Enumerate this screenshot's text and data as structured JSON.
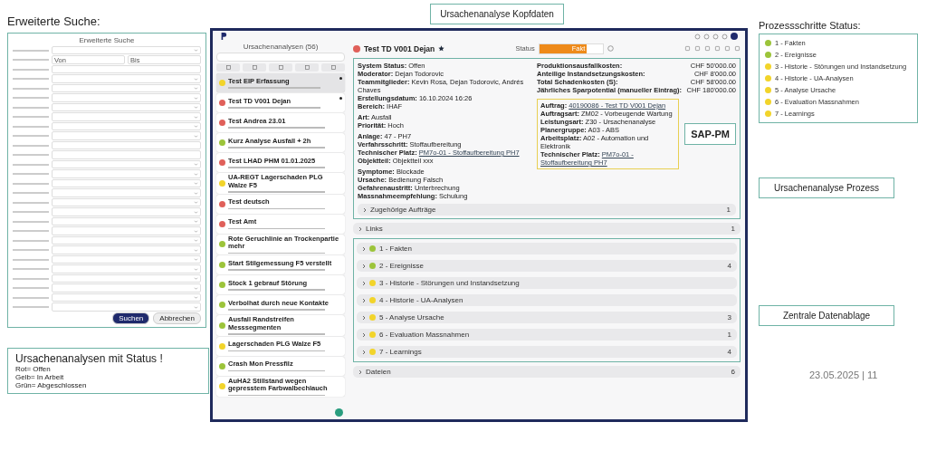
{
  "slide": {
    "date": "23.05.2025 | 11"
  },
  "search_panel": {
    "heading": "Erweiterte Suche:",
    "title": "Erweiterte Suche",
    "range": [
      "Von",
      "Bis"
    ],
    "fields": [
      {
        "kind": "select"
      },
      {
        "kind": "range"
      },
      {
        "kind": "text"
      },
      {
        "kind": "select"
      },
      {
        "kind": "select"
      },
      {
        "kind": "select"
      },
      {
        "kind": "select"
      },
      {
        "kind": "select"
      },
      {
        "kind": "select"
      },
      {
        "kind": "select"
      },
      {
        "kind": "text"
      },
      {
        "kind": "text"
      },
      {
        "kind": "select"
      },
      {
        "kind": "select"
      },
      {
        "kind": "select"
      },
      {
        "kind": "select"
      },
      {
        "kind": "select"
      },
      {
        "kind": "select"
      },
      {
        "kind": "select"
      },
      {
        "kind": "select"
      },
      {
        "kind": "select"
      },
      {
        "kind": "select"
      },
      {
        "kind": "select"
      },
      {
        "kind": "select"
      },
      {
        "kind": "select"
      },
      {
        "kind": "select"
      },
      {
        "kind": "select"
      },
      {
        "kind": "select"
      }
    ],
    "buttons": [
      {
        "label": "Suchen",
        "primary": true
      },
      {
        "label": "Abbrechen",
        "primary": false
      }
    ]
  },
  "status_note": {
    "title": "Ursachenanalysen mit Status !",
    "lines": [
      "Rot= Offen",
      "Gelb= In Arbeit",
      "Grün= Abgeschlossen"
    ]
  },
  "header_callout": "Ursachenanalyse Kopfdaten",
  "list": {
    "title": "Ursachenanalysen (56)",
    "items": [
      {
        "title": "Test EIP Erfassung",
        "color": "#f2d42a",
        "selected": true,
        "pinned": true
      },
      {
        "title": "Test TD V001 Dejan",
        "color": "#e0605a",
        "selected": false,
        "pinned": true
      },
      {
        "title": "Test Andrea 23.01",
        "color": "#e0605a",
        "selected": false,
        "pinned": false
      },
      {
        "title": "Kurz Analyse Ausfall + 2h",
        "color": "#9cc43a",
        "selected": false,
        "pinned": false
      },
      {
        "title": "Test LHAD PHM 01.01.2025",
        "color": "#e0605a",
        "selected": false,
        "pinned": false
      },
      {
        "title": "UA-REGT Lagerschaden PLG Walze F5",
        "color": "#f2d42a",
        "selected": false,
        "pinned": false
      },
      {
        "title": "Test deutsch",
        "color": "#e0605a",
        "selected": false,
        "pinned": false
      },
      {
        "title": "Test Amt",
        "color": "#e0605a",
        "selected": false,
        "pinned": false
      },
      {
        "title": "Rote Geruchlinie an Trockenpartie mehr",
        "color": "#9cc43a",
        "selected": false,
        "pinned": false
      },
      {
        "title": "Start Stilgemessung F5 verstellt",
        "color": "#9cc43a",
        "selected": false,
        "pinned": false
      },
      {
        "title": "Stock 1 gebrauf Störung",
        "color": "#9cc43a",
        "selected": false,
        "pinned": false
      },
      {
        "title": "Verbolhat durch neue Kontakte",
        "color": "#9cc43a",
        "selected": false,
        "pinned": false
      },
      {
        "title": "Ausfall Randstreifen Messsegmenten",
        "color": "#9cc43a",
        "selected": false,
        "pinned": false
      },
      {
        "title": "Lagerschaden PLG Walze F5",
        "color": "#f2d42a",
        "selected": false,
        "pinned": false
      },
      {
        "title": "Crash Mon Pressfilz",
        "color": "#9cc43a",
        "selected": false,
        "pinned": false
      },
      {
        "title": "AuHA2 Stillstand wegen gepresstem Farbwalbechlauch",
        "color": "#f2d42a",
        "selected": false,
        "pinned": false
      }
    ]
  },
  "detail": {
    "title": "Test TD V001 Dejan",
    "color": "#e0605a",
    "status": {
      "label": "Status",
      "text": "Fakt",
      "level": 0.75
    },
    "field_groups": [
      {
        "fields": [
          {
            "label": "System Status:",
            "value": "Offen",
            "link": false
          },
          {
            "label": "Moderator:",
            "value": "Dejan Todorovic",
            "link": false
          },
          {
            "label": "Teammitglieder:",
            "value": "Kevin Rosa, Dejan Todorovic, Andrés Chaves",
            "link": false
          },
          {
            "label": "Erstellungsdatum:",
            "value": "16.10.2024 16:26",
            "link": false
          },
          {
            "label": "Bereich:",
            "value": "IHAF",
            "link": false
          }
        ]
      },
      {
        "fields": [
          {
            "label": "Art:",
            "value": "Ausfall",
            "link": false
          },
          {
            "label": "Priorität:",
            "value": "Hoch",
            "link": false
          }
        ]
      },
      {
        "fields": [
          {
            "label": "Anlage:",
            "value": "47 - PH7",
            "link": false
          },
          {
            "label": "Verfahrsschritt:",
            "value": "Stoffaufbereitung",
            "link": false
          },
          {
            "label": "Technischer Platz:",
            "value": "PM7o-01 - Stoffaufbereitung PH7",
            "link": true
          },
          {
            "label": "Objektteil:",
            "value": "Objektteil xxx",
            "link": false
          }
        ]
      },
      {
        "fields": [
          {
            "label": "Symptome:",
            "value": "Blockade",
            "link": false
          },
          {
            "label": "Ursache:",
            "value": "Bedienung Falsch",
            "link": false
          },
          {
            "label": "Gefahrenaustritt:",
            "value": "Unterbrechung",
            "link": false
          },
          {
            "label": "Massnahmeempfehlung:",
            "value": "Schulung",
            "link": false
          }
        ]
      }
    ],
    "costs": [
      {
        "label": "Produktionsausfallkosten:",
        "value": "CHF 50'000.00"
      },
      {
        "label": "Anteilige Instandsetzungskosten:",
        "value": "CHF 8'000.00"
      },
      {
        "label": "Total Schadenkosten (S):",
        "value": "CHF 58'000.00"
      },
      {
        "label": "Jährliches Sparpotential (manueller Eintrag):",
        "value": "CHF 180'000.00"
      }
    ],
    "sap": [
      {
        "label": "Auftrag:",
        "value": "40190086 - Test TD V001 Dejan",
        "link": true
      },
      {
        "label": "Auftragsart:",
        "value": "ZM02 - Vorbeugende Wartung",
        "link": false
      },
      {
        "label": "Leistungsart:",
        "value": "Z30 - Ursachenanalyse",
        "link": false
      },
      {
        "label": "Planergruppe:",
        "value": "A03 - ABS",
        "link": false
      },
      {
        "label": "Arbeitsplatz:",
        "value": "A02 - Automation und Elektronik",
        "link": false
      },
      {
        "label": "Technischer Platz:",
        "value": "PM7o-01 - Stoffaufbereitung PH7",
        "link": true
      }
    ],
    "sap_callout": "SAP-PM",
    "head_sections": [
      {
        "title": "Zugehörige Aufträge",
        "count": "1"
      }
    ],
    "top_sections": [
      {
        "title": "Links",
        "count": "1"
      }
    ],
    "process_sections": [
      {
        "title": "1 - Fakten",
        "color": "#9cc43a"
      },
      {
        "title": "2 - Ereignisse",
        "count": "4",
        "color": "#9cc43a"
      },
      {
        "title": "3 - Historie - Störungen und Instandsetzung",
        "color": "#f2d42a"
      },
      {
        "title": "4 - Historie - UA-Analysen",
        "color": "#f2d42a"
      },
      {
        "title": "5 - Analyse Ursache",
        "count": "3",
        "color": "#f2d42a"
      },
      {
        "title": "6 - Evaluation Massnahmen",
        "count": "1",
        "color": "#f2d42a"
      },
      {
        "title": "7 - Learnings",
        "count": "4",
        "color": "#f2d42a"
      }
    ],
    "bottom_sections": [
      {
        "title": "Dateien",
        "count": "6"
      }
    ]
  },
  "steps_legend": {
    "heading": "Prozessschritte Status:",
    "items": [
      {
        "label": "1 - Fakten",
        "color": "#9cc43a"
      },
      {
        "label": "2 - Ereignisse",
        "color": "#9cc43a"
      },
      {
        "label": "3 - Historie - Störungen und Instandsetzung",
        "color": "#f2d42a"
      },
      {
        "label": "4 - Historie - UA-Analysen",
        "color": "#f2d42a"
      },
      {
        "label": "5 - Analyse Ursache",
        "color": "#f2d42a"
      },
      {
        "label": "6 - Evaluation Massnahmen",
        "color": "#f2d42a"
      },
      {
        "label": "7 - Learnings",
        "color": "#f2d42a"
      }
    ]
  },
  "callouts": [
    "Ursachenanalyse Prozess",
    "Zentrale Datenablage"
  ]
}
